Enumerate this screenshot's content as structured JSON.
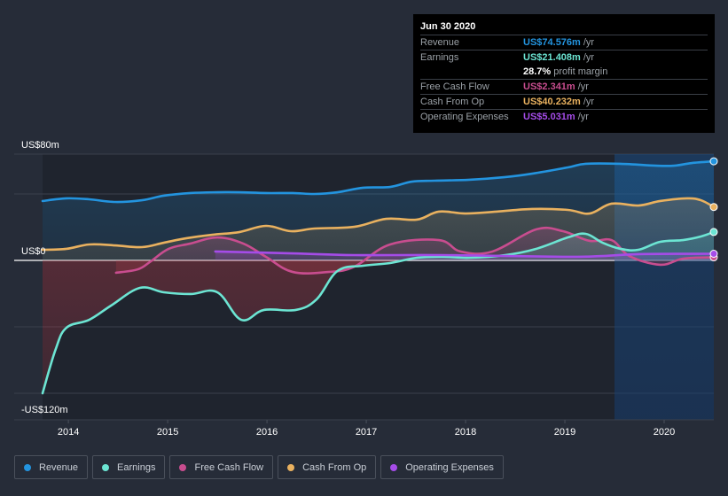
{
  "tooltip": {
    "date": "Jun 30 2020",
    "rows": [
      {
        "label": "Revenue",
        "value": "US$74.576m",
        "unit": "/yr",
        "color": "#2394df"
      },
      {
        "label": "Earnings",
        "value": "US$21.408m",
        "unit": "/yr",
        "color": "#6ce5d3"
      },
      {
        "label": "",
        "value": "28.7%",
        "unit": "profit margin",
        "color": "#ffffff"
      },
      {
        "label": "Free Cash Flow",
        "value": "US$2.341m",
        "unit": "/yr",
        "color": "#c84d8f"
      },
      {
        "label": "Cash From Op",
        "value": "US$40.232m",
        "unit": "/yr",
        "color": "#e9b15f"
      },
      {
        "label": "Operating Expenses",
        "value": "US$5.031m",
        "unit": "/yr",
        "color": "#a54ce8"
      }
    ]
  },
  "legend": [
    {
      "label": "Revenue",
      "color": "#2394df"
    },
    {
      "label": "Earnings",
      "color": "#6ce5d3"
    },
    {
      "label": "Free Cash Flow",
      "color": "#c84d8f"
    },
    {
      "label": "Cash From Op",
      "color": "#e9b15f"
    },
    {
      "label": "Operating Expenses",
      "color": "#a54ce8"
    }
  ],
  "chart_data": {
    "type": "line",
    "title": "",
    "xlabel": "",
    "ylabel": "",
    "unit": "US$m",
    "xlim": [
      2013.74,
      2020.5
    ],
    "ylim": [
      -120,
      80
    ],
    "y_tick_labels": [
      {
        "value": 80,
        "label": "US$80m"
      },
      {
        "value": 0,
        "label": "US$0"
      },
      {
        "value": -120,
        "label": "-US$120m"
      }
    ],
    "y_gridlines": [
      80,
      50,
      0,
      -50,
      -100
    ],
    "x_ticks": [
      {
        "value": 2014,
        "label": "2014"
      },
      {
        "value": 2015,
        "label": "2015"
      },
      {
        "value": 2016,
        "label": "2016"
      },
      {
        "value": 2017,
        "label": "2017"
      },
      {
        "value": 2018,
        "label": "2018"
      },
      {
        "value": 2019,
        "label": "2019"
      },
      {
        "value": 2020,
        "label": "2020"
      }
    ],
    "highlight_range": [
      2019.5,
      2020.5
    ],
    "grid": true,
    "legend_position": "bottom-left",
    "series": [
      {
        "name": "Revenue",
        "key": "revenue",
        "color": "#2394df",
        "points": [
          [
            2013.74,
            44.7
          ],
          [
            2013.98,
            46.7
          ],
          [
            2014.21,
            46.0
          ],
          [
            2014.47,
            44.0
          ],
          [
            2014.74,
            45.3
          ],
          [
            2014.96,
            48.7
          ],
          [
            2015.23,
            50.7
          ],
          [
            2015.5,
            51.3
          ],
          [
            2015.72,
            51.3
          ],
          [
            2015.99,
            50.7
          ],
          [
            2016.26,
            50.7
          ],
          [
            2016.48,
            50.0
          ],
          [
            2016.71,
            51.3
          ],
          [
            2016.97,
            54.7
          ],
          [
            2017.24,
            55.3
          ],
          [
            2017.46,
            59.3
          ],
          [
            2017.69,
            60.0
          ],
          [
            2018.04,
            60.7
          ],
          [
            2018.4,
            62.7
          ],
          [
            2018.67,
            65.3
          ],
          [
            2019.03,
            70.0
          ],
          [
            2019.21,
            72.7
          ],
          [
            2019.56,
            72.7
          ],
          [
            2019.92,
            71.3
          ],
          [
            2020.1,
            71.3
          ],
          [
            2020.28,
            73.3
          ],
          [
            2020.5,
            74.6
          ]
        ]
      },
      {
        "name": "Cash From Op",
        "key": "cfo",
        "color": "#e9b15f",
        "points": [
          [
            2013.74,
            8.0
          ],
          [
            2013.98,
            8.7
          ],
          [
            2014.21,
            12.0
          ],
          [
            2014.47,
            11.3
          ],
          [
            2014.74,
            10.0
          ],
          [
            2014.96,
            13.3
          ],
          [
            2015.19,
            16.7
          ],
          [
            2015.45,
            19.3
          ],
          [
            2015.72,
            21.3
          ],
          [
            2015.99,
            26.0
          ],
          [
            2016.24,
            22.0
          ],
          [
            2016.48,
            24.0
          ],
          [
            2016.88,
            25.3
          ],
          [
            2017.2,
            31.3
          ],
          [
            2017.51,
            30.7
          ],
          [
            2017.73,
            36.7
          ],
          [
            2018.0,
            35.3
          ],
          [
            2018.31,
            36.7
          ],
          [
            2018.67,
            38.7
          ],
          [
            2019.03,
            38.0
          ],
          [
            2019.25,
            35.3
          ],
          [
            2019.47,
            42.7
          ],
          [
            2019.74,
            41.3
          ],
          [
            2019.96,
            44.7
          ],
          [
            2020.23,
            46.7
          ],
          [
            2020.37,
            45.3
          ],
          [
            2020.5,
            40.2
          ]
        ]
      },
      {
        "name": "Earnings",
        "key": "earnings",
        "color": "#6ce5d3",
        "points": [
          [
            2013.74,
            -100.0
          ],
          [
            2013.87,
            -67.3
          ],
          [
            2013.98,
            -50.7
          ],
          [
            2014.21,
            -44.7
          ],
          [
            2014.43,
            -34.0
          ],
          [
            2014.72,
            -20.7
          ],
          [
            2014.96,
            -24.0
          ],
          [
            2015.23,
            -25.3
          ],
          [
            2015.5,
            -24.0
          ],
          [
            2015.74,
            -44.7
          ],
          [
            2015.97,
            -37.3
          ],
          [
            2016.29,
            -37.3
          ],
          [
            2016.5,
            -29.3
          ],
          [
            2016.71,
            -8.0
          ],
          [
            2016.97,
            -4.0
          ],
          [
            2017.24,
            -2.0
          ],
          [
            2017.51,
            2.0
          ],
          [
            2017.78,
            2.7
          ],
          [
            2018.04,
            2.0
          ],
          [
            2018.4,
            4.0
          ],
          [
            2018.71,
            8.7
          ],
          [
            2019.03,
            17.3
          ],
          [
            2019.21,
            20.0
          ],
          [
            2019.38,
            13.3
          ],
          [
            2019.56,
            8.7
          ],
          [
            2019.74,
            8.0
          ],
          [
            2019.96,
            14.0
          ],
          [
            2020.19,
            15.3
          ],
          [
            2020.37,
            18.0
          ],
          [
            2020.5,
            21.4
          ]
        ]
      },
      {
        "name": "Free Cash Flow",
        "key": "fcf",
        "color": "#c84d8f",
        "points": [
          [
            2014.48,
            -9.3
          ],
          [
            2014.7,
            -6.7
          ],
          [
            2014.83,
            -0.7
          ],
          [
            2015.01,
            8.7
          ],
          [
            2015.23,
            12.7
          ],
          [
            2015.5,
            17.3
          ],
          [
            2015.76,
            12.7
          ],
          [
            2015.99,
            2.7
          ],
          [
            2016.26,
            -8.7
          ],
          [
            2016.62,
            -8.7
          ],
          [
            2016.88,
            -4.7
          ],
          [
            2017.24,
            12.0
          ],
          [
            2017.73,
            15.3
          ],
          [
            2017.95,
            6.7
          ],
          [
            2018.27,
            6.7
          ],
          [
            2018.71,
            23.3
          ],
          [
            2018.98,
            22.0
          ],
          [
            2019.25,
            14.7
          ],
          [
            2019.47,
            15.3
          ],
          [
            2019.65,
            3.3
          ],
          [
            2019.96,
            -3.3
          ],
          [
            2020.19,
            1.3
          ],
          [
            2020.5,
            2.3
          ]
        ]
      },
      {
        "name": "Operating Expenses",
        "key": "opex",
        "color": "#a54ce8",
        "points": [
          [
            2015.48,
            6.7
          ],
          [
            2016.26,
            5.3
          ],
          [
            2016.88,
            4.0
          ],
          [
            2017.78,
            4.0
          ],
          [
            2018.98,
            2.7
          ],
          [
            2019.38,
            3.3
          ],
          [
            2019.74,
            4.7
          ],
          [
            2020.5,
            5.0
          ]
        ]
      }
    ]
  }
}
